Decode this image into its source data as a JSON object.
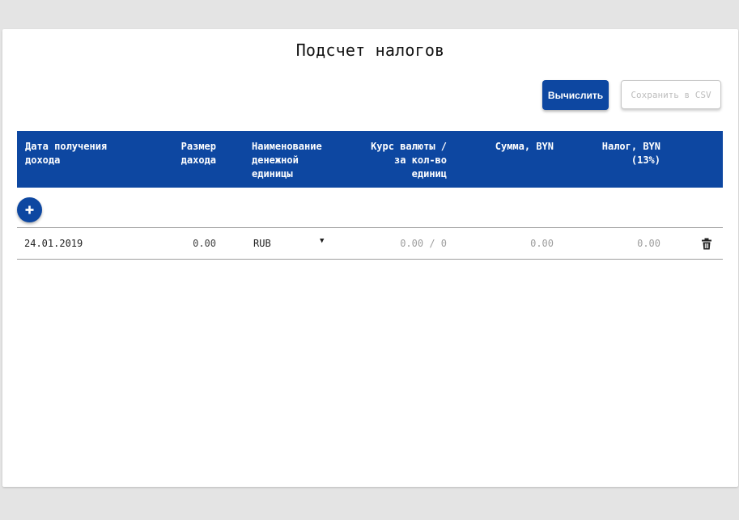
{
  "page": {
    "title": "Подсчет налогов"
  },
  "toolbar": {
    "calculate_label": "Вычислить",
    "save_csv_label": "Сохранить в CSV"
  },
  "table": {
    "headers": {
      "date": "Дата получения\nдохода",
      "amount": "Размер\nдахода",
      "currency": "Наименование\nденежной\nединицы",
      "rate": "Курс валюты /\nза кол-во\nединиц",
      "sum": "Сумма, BYN",
      "tax": "Налог, BYN\n(13%)"
    },
    "add_button_icon": "plus-icon",
    "rows": [
      {
        "date": "24.01.2019",
        "amount": "0.00",
        "currency": "RUB",
        "rate": "0.00 / 0",
        "sum": "0.00",
        "tax": "0.00",
        "delete_icon": "trash-icon"
      }
    ]
  },
  "colors": {
    "primary": "#0d47a1",
    "background": "#e4e4e4",
    "card": "#ffffff",
    "muted_text": "#9e9e9e"
  }
}
